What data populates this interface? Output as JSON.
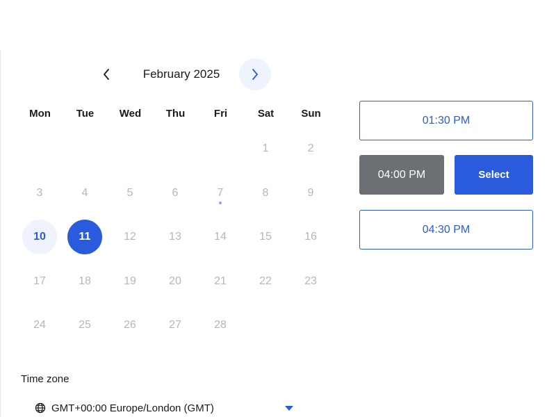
{
  "calendar": {
    "month_title": "February 2025",
    "weekdays": [
      "Mon",
      "Tue",
      "Wed",
      "Thu",
      "Fri",
      "Sat",
      "Sun"
    ],
    "days": [
      {
        "label": "1",
        "col": 5,
        "row": 0,
        "state": "disabled"
      },
      {
        "label": "2",
        "col": 6,
        "row": 0,
        "state": "disabled"
      },
      {
        "label": "3",
        "col": 0,
        "row": 1,
        "state": "disabled"
      },
      {
        "label": "4",
        "col": 1,
        "row": 1,
        "state": "disabled"
      },
      {
        "label": "5",
        "col": 2,
        "row": 1,
        "state": "disabled"
      },
      {
        "label": "6",
        "col": 3,
        "row": 1,
        "state": "disabled"
      },
      {
        "label": "7",
        "col": 4,
        "row": 1,
        "state": "today"
      },
      {
        "label": "8",
        "col": 5,
        "row": 1,
        "state": "disabled"
      },
      {
        "label": "9",
        "col": 6,
        "row": 1,
        "state": "disabled"
      },
      {
        "label": "10",
        "col": 0,
        "row": 2,
        "state": "available"
      },
      {
        "label": "11",
        "col": 1,
        "row": 2,
        "state": "selected"
      },
      {
        "label": "12",
        "col": 2,
        "row": 2,
        "state": "disabled"
      },
      {
        "label": "13",
        "col": 3,
        "row": 2,
        "state": "disabled"
      },
      {
        "label": "14",
        "col": 4,
        "row": 2,
        "state": "disabled"
      },
      {
        "label": "15",
        "col": 5,
        "row": 2,
        "state": "disabled"
      },
      {
        "label": "16",
        "col": 6,
        "row": 2,
        "state": "disabled"
      },
      {
        "label": "17",
        "col": 0,
        "row": 3,
        "state": "disabled"
      },
      {
        "label": "18",
        "col": 1,
        "row": 3,
        "state": "disabled"
      },
      {
        "label": "19",
        "col": 2,
        "row": 3,
        "state": "disabled"
      },
      {
        "label": "20",
        "col": 3,
        "row": 3,
        "state": "disabled"
      },
      {
        "label": "21",
        "col": 4,
        "row": 3,
        "state": "disabled"
      },
      {
        "label": "22",
        "col": 5,
        "row": 3,
        "state": "disabled"
      },
      {
        "label": "23",
        "col": 6,
        "row": 3,
        "state": "disabled"
      },
      {
        "label": "24",
        "col": 0,
        "row": 4,
        "state": "disabled"
      },
      {
        "label": "25",
        "col": 1,
        "row": 4,
        "state": "disabled"
      },
      {
        "label": "26",
        "col": 2,
        "row": 4,
        "state": "disabled"
      },
      {
        "label": "27",
        "col": 3,
        "row": 4,
        "state": "disabled"
      },
      {
        "label": "28",
        "col": 4,
        "row": 4,
        "state": "disabled"
      }
    ],
    "prev_icon": "chevron-left-icon",
    "next_icon": "chevron-right-icon"
  },
  "time_slots": {
    "slot_1": "01:30 PM",
    "slot_2_selected": "04:00 PM",
    "select_label": "Select",
    "slot_3": "04:30 PM"
  },
  "timezone": {
    "label": "Time zone",
    "value": "GMT+00:00 Europe/London (GMT)",
    "icon": "globe-icon",
    "caret_icon": "caret-down-icon"
  },
  "colors": {
    "accent": "#2a5bdd",
    "accent_light": "#eef3fe",
    "chosen_slot": "#6c6f73",
    "muted_text": "#b6b6b6"
  }
}
